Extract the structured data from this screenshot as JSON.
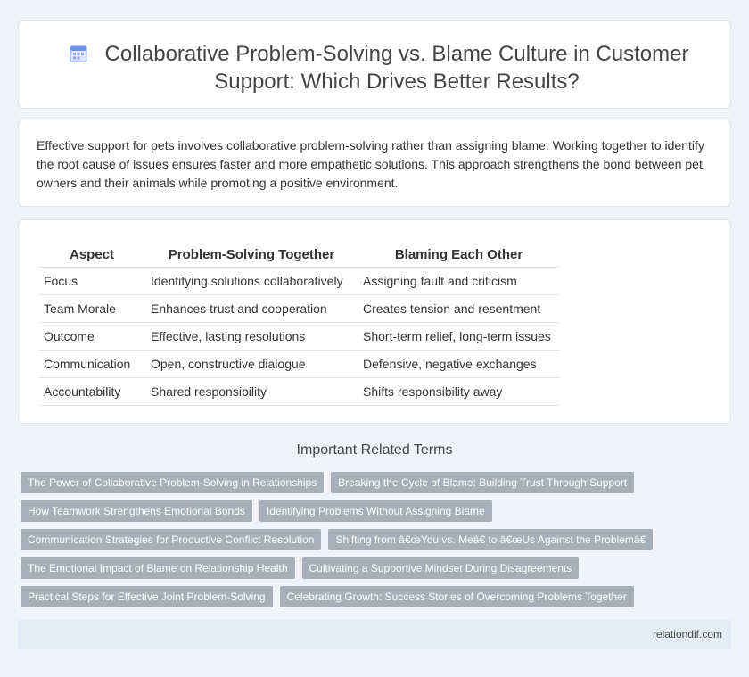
{
  "header": {
    "title": "Collaborative Problem-Solving vs. Blame Culture in Customer Support: Which Drives Better Results?",
    "icon": "calendar-icon"
  },
  "intro": {
    "text": "Effective support for pets involves collaborative problem-solving rather than assigning blame. Working together to identify the root cause of issues ensures faster and more empathetic solutions. This approach strengthens the bond between pet owners and their animals while promoting a positive environment."
  },
  "table": {
    "headers": [
      "Aspect",
      "Problem-Solving Together",
      "Blaming Each Other"
    ],
    "rows": [
      [
        "Focus",
        "Identifying solutions collaboratively",
        "Assigning fault and criticism"
      ],
      [
        "Team Morale",
        "Enhances trust and cooperation",
        "Creates tension and resentment"
      ],
      [
        "Outcome",
        "Effective, lasting resolutions",
        "Short-term relief, long-term issues"
      ],
      [
        "Communication",
        "Open, constructive dialogue",
        "Defensive, negative exchanges"
      ],
      [
        "Accountability",
        "Shared responsibility",
        "Shifts responsibility away"
      ]
    ]
  },
  "related": {
    "title": "Important Related Terms",
    "rows": [
      [
        "The Power of Collaborative Problem-Solving in Relationships",
        "Breaking the Cycle of Blame: Building Trust Through Support"
      ],
      [
        "How Teamwork Strengthens Emotional Bonds",
        "Identifying Problems Without Assigning Blame"
      ],
      [
        "Communication Strategies for Productive Conflict Resolution",
        "Shifting from â€œYou vs. Meâ€ to â€œUs Against the Problemâ€"
      ],
      [
        "The Emotional Impact of Blame on Relationship Health",
        "Cultivating a Supportive Mindset During Disagreements"
      ],
      [
        "Practical Steps for Effective Joint Problem-Solving",
        "Celebrating Growth: Success Stories of Overcoming Problems Together"
      ]
    ]
  },
  "footer": {
    "site": "relationdif.com"
  }
}
